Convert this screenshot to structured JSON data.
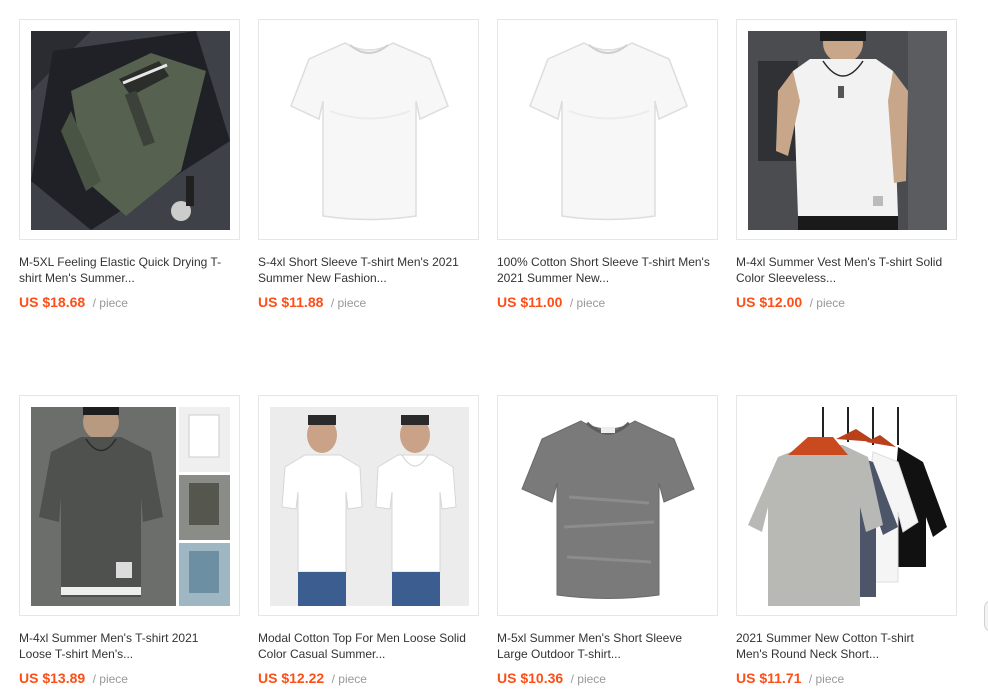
{
  "colors": {
    "price": "#ff4e16",
    "unit": "#999999",
    "title": "#333333",
    "border": "#e6e6e6"
  },
  "products": [
    {
      "image_icon": "polo-shirt-in-gift-box-photo",
      "title_line1": "M-5XL Feeling Elastic Quick Drying T-",
      "title_line2": "shirt Men's Summer...",
      "price": "US $18.68",
      "unit": "/ piece"
    },
    {
      "image_icon": "white-tshirt-photo",
      "title_line1": "S-4xl Short Sleeve T-shirt Men's 2021",
      "title_line2": "Summer New Fashion...",
      "price": "US $11.88",
      "unit": "/ piece"
    },
    {
      "image_icon": "white-tshirt-photo",
      "title_line1": "100% Cotton Short Sleeve T-shirt Men's",
      "title_line2": "2021 Summer New...",
      "price": "US $11.00",
      "unit": "/ piece"
    },
    {
      "image_icon": "man-in-white-vest-photo",
      "title_line1": "M-4xl Summer Vest Men's T-shirt Solid",
      "title_line2": "Color Sleeveless...",
      "price": "US $12.00",
      "unit": "/ piece"
    },
    {
      "image_icon": "man-in-gray-tshirt-collage-photo",
      "title_line1": "M-4xl Summer Men's T-shirt 2021",
      "title_line2": "Loose T-shirt Men's...",
      "price": "US $13.89",
      "unit": "/ piece"
    },
    {
      "image_icon": "two-men-in-white-tshirts-photo",
      "title_line1": "Modal Cotton Top For Men Loose Solid",
      "title_line2": "Color Casual Summer...",
      "price": "US $12.22",
      "unit": "/ piece"
    },
    {
      "image_icon": "heather-gray-tshirt-photo",
      "title_line1": "M-5xl Summer Men's Short Sleeve",
      "title_line2": "Large Outdoor T-shirt...",
      "price": "US $10.36",
      "unit": "/ piece"
    },
    {
      "image_icon": "tshirts-on-hangers-photo",
      "title_line1": "2021 Summer New Cotton T-shirt",
      "title_line2": "Men's Round Neck Short...",
      "price": "US $11.71",
      "unit": "/ piece"
    }
  ]
}
